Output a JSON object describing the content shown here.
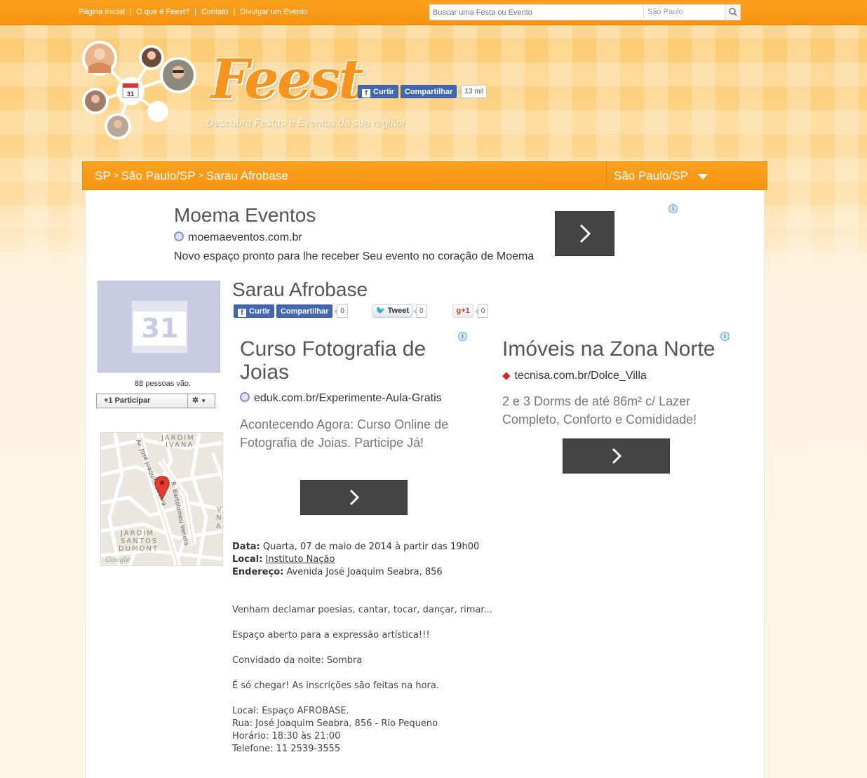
{
  "topnav": {
    "items": [
      "Página Inicial",
      "O que é Feest?",
      "Contato",
      "Divulgar um Evento"
    ],
    "search_placeholder": "Buscar uma Festa ou Evento",
    "search_city": "São Paulo"
  },
  "header": {
    "logo": "Feest",
    "tagline": "Descubra Festas e Eventos da sua região!",
    "like_label": "Curtir",
    "share_label": "Compartilhar",
    "share_count": "13 mil"
  },
  "breadcrumb": {
    "items": [
      "SP",
      "São Paulo/SP",
      "Sarau Afrobase"
    ],
    "separator": ">",
    "city_selector": "São Paulo/SP"
  },
  "ad_top": {
    "title": "Moema Eventos",
    "url": "moemaeventos.com.br",
    "description": "Novo espaço pronto para lhe receber Seu evento no coração de Moema"
  },
  "event": {
    "image_day": "31",
    "going": "88 pessoas vão.",
    "participate_label": "+1  Participar",
    "title": "Sarau Afrobase",
    "social": {
      "like_label": "Curtir",
      "share_label": "Compartilhar",
      "fb_count": "0",
      "tweet_label": "Tweet",
      "tweet_count": "0",
      "gplus_label": "g+1",
      "gplus_count": "0"
    },
    "details": {
      "date_label": "Data:",
      "date_value": "Quarta, 07 de maio de 2014 à partir das 19h00",
      "place_label": "Local:",
      "place_value": "Instituto Nação",
      "address_label": "Endereço:",
      "address_value": "Avenida José Joaquim Seabra, 856"
    },
    "description": [
      "Venham declamar poesias, cantar, tocar, dançar, rimar...",
      "Espaço aberto para a expressão artística!!!",
      "Convidado da noite: Sombra",
      "É só chegar! As inscrições são feitas na hora."
    ],
    "description_footer": [
      "Local: Espaço AFROBASE.",
      "Rua: José Joaquim Seabra, 856 - Rio Pequeno",
      "Horário: 18:30 às 21:00",
      "Telefone: 11 2539-3555"
    ]
  },
  "map": {
    "labels": [
      "JARDIM",
      "IVANA",
      "JARDIM",
      "SANTOS",
      "DUMONT",
      "Av. José Joaquim Seabra",
      "R. Bartolomeu Veneto",
      "V",
      "N",
      "A",
      "Google"
    ]
  },
  "ad_left": {
    "title": "Curso Fotografia de Joias",
    "url": "eduk.com.br/Experimente-Aula-Gratis",
    "description": "Acontecendo Agora: Curso Online de Fotografia de Joias. Participe Já!"
  },
  "ad_right": {
    "title": "Imóveis na Zona Norte",
    "url": "tecnisa.com.br/Dolce_Villa",
    "description": "2 e 3 Dorms de até 86m² c/ Lazer Completo, Conforto e Comididade!"
  },
  "colors": {
    "orange": "#f7941d",
    "facebook": "#4267b2",
    "ad_button": "#444444"
  }
}
